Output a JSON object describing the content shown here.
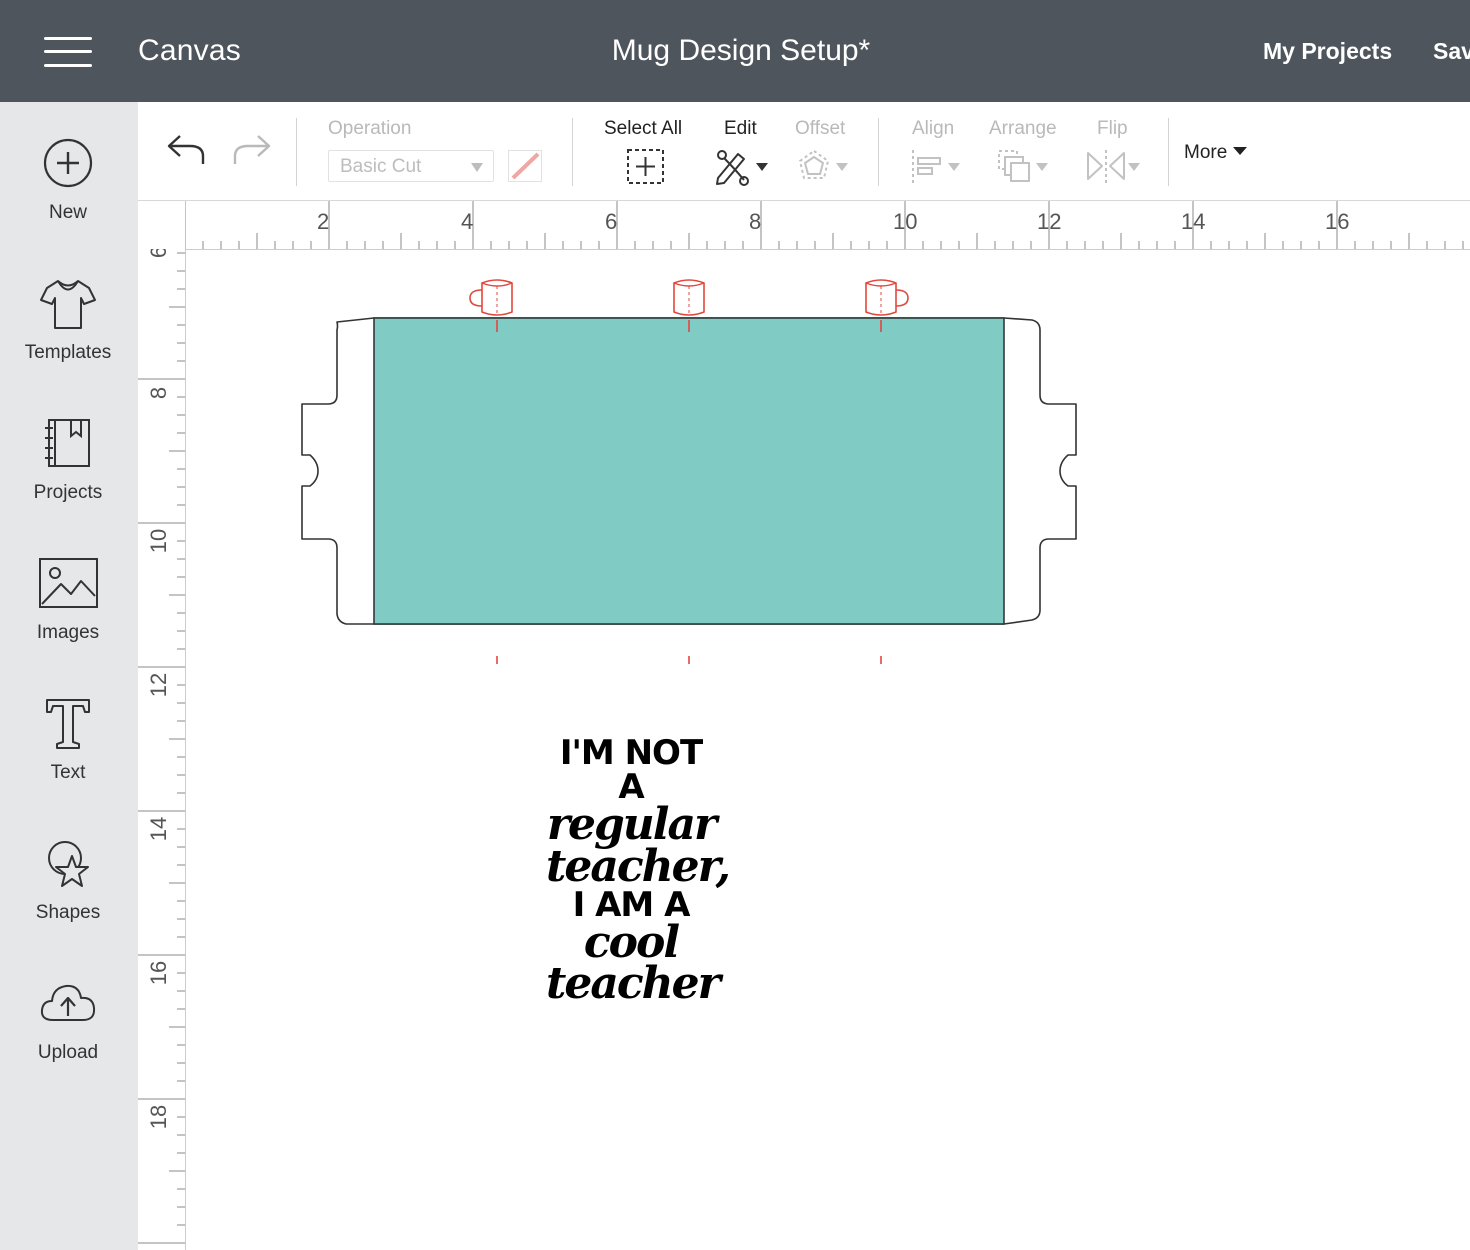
{
  "header": {
    "app_title": "Canvas",
    "document_title": "Mug Design Setup*",
    "my_projects": "My Projects",
    "save": "Sav"
  },
  "sidebar": {
    "items": [
      {
        "label": "New",
        "icon": "plus-circle-icon"
      },
      {
        "label": "Templates",
        "icon": "tshirt-icon"
      },
      {
        "label": "Projects",
        "icon": "notebook-icon"
      },
      {
        "label": "Images",
        "icon": "image-icon"
      },
      {
        "label": "Text",
        "icon": "text-t-icon"
      },
      {
        "label": "Shapes",
        "icon": "shapes-icon"
      },
      {
        "label": "Upload",
        "icon": "cloud-upload-icon"
      }
    ]
  },
  "toolbar": {
    "operation_label": "Operation",
    "operation_value": "Basic Cut",
    "select_all": "Select All",
    "edit": "Edit",
    "offset": "Offset",
    "align": "Align",
    "arrange": "Arrange",
    "flip": "Flip",
    "more": "More"
  },
  "rulers": {
    "x_labels": [
      "2",
      "4",
      "6",
      "8",
      "10",
      "12",
      "14",
      "16"
    ],
    "y_labels": [
      "6",
      "8",
      "10",
      "12",
      "14",
      "16",
      "18"
    ]
  },
  "design": {
    "lines": [
      "I'M NOT A",
      "regular",
      "teacher,",
      "I AM A",
      "cool",
      "teacher"
    ],
    "mug_panel_color": "#80ccc4",
    "guide_color": "#e0483e"
  },
  "colors": {
    "header_bg": "#4e555c",
    "sidebar_bg": "#e6e7e8"
  }
}
